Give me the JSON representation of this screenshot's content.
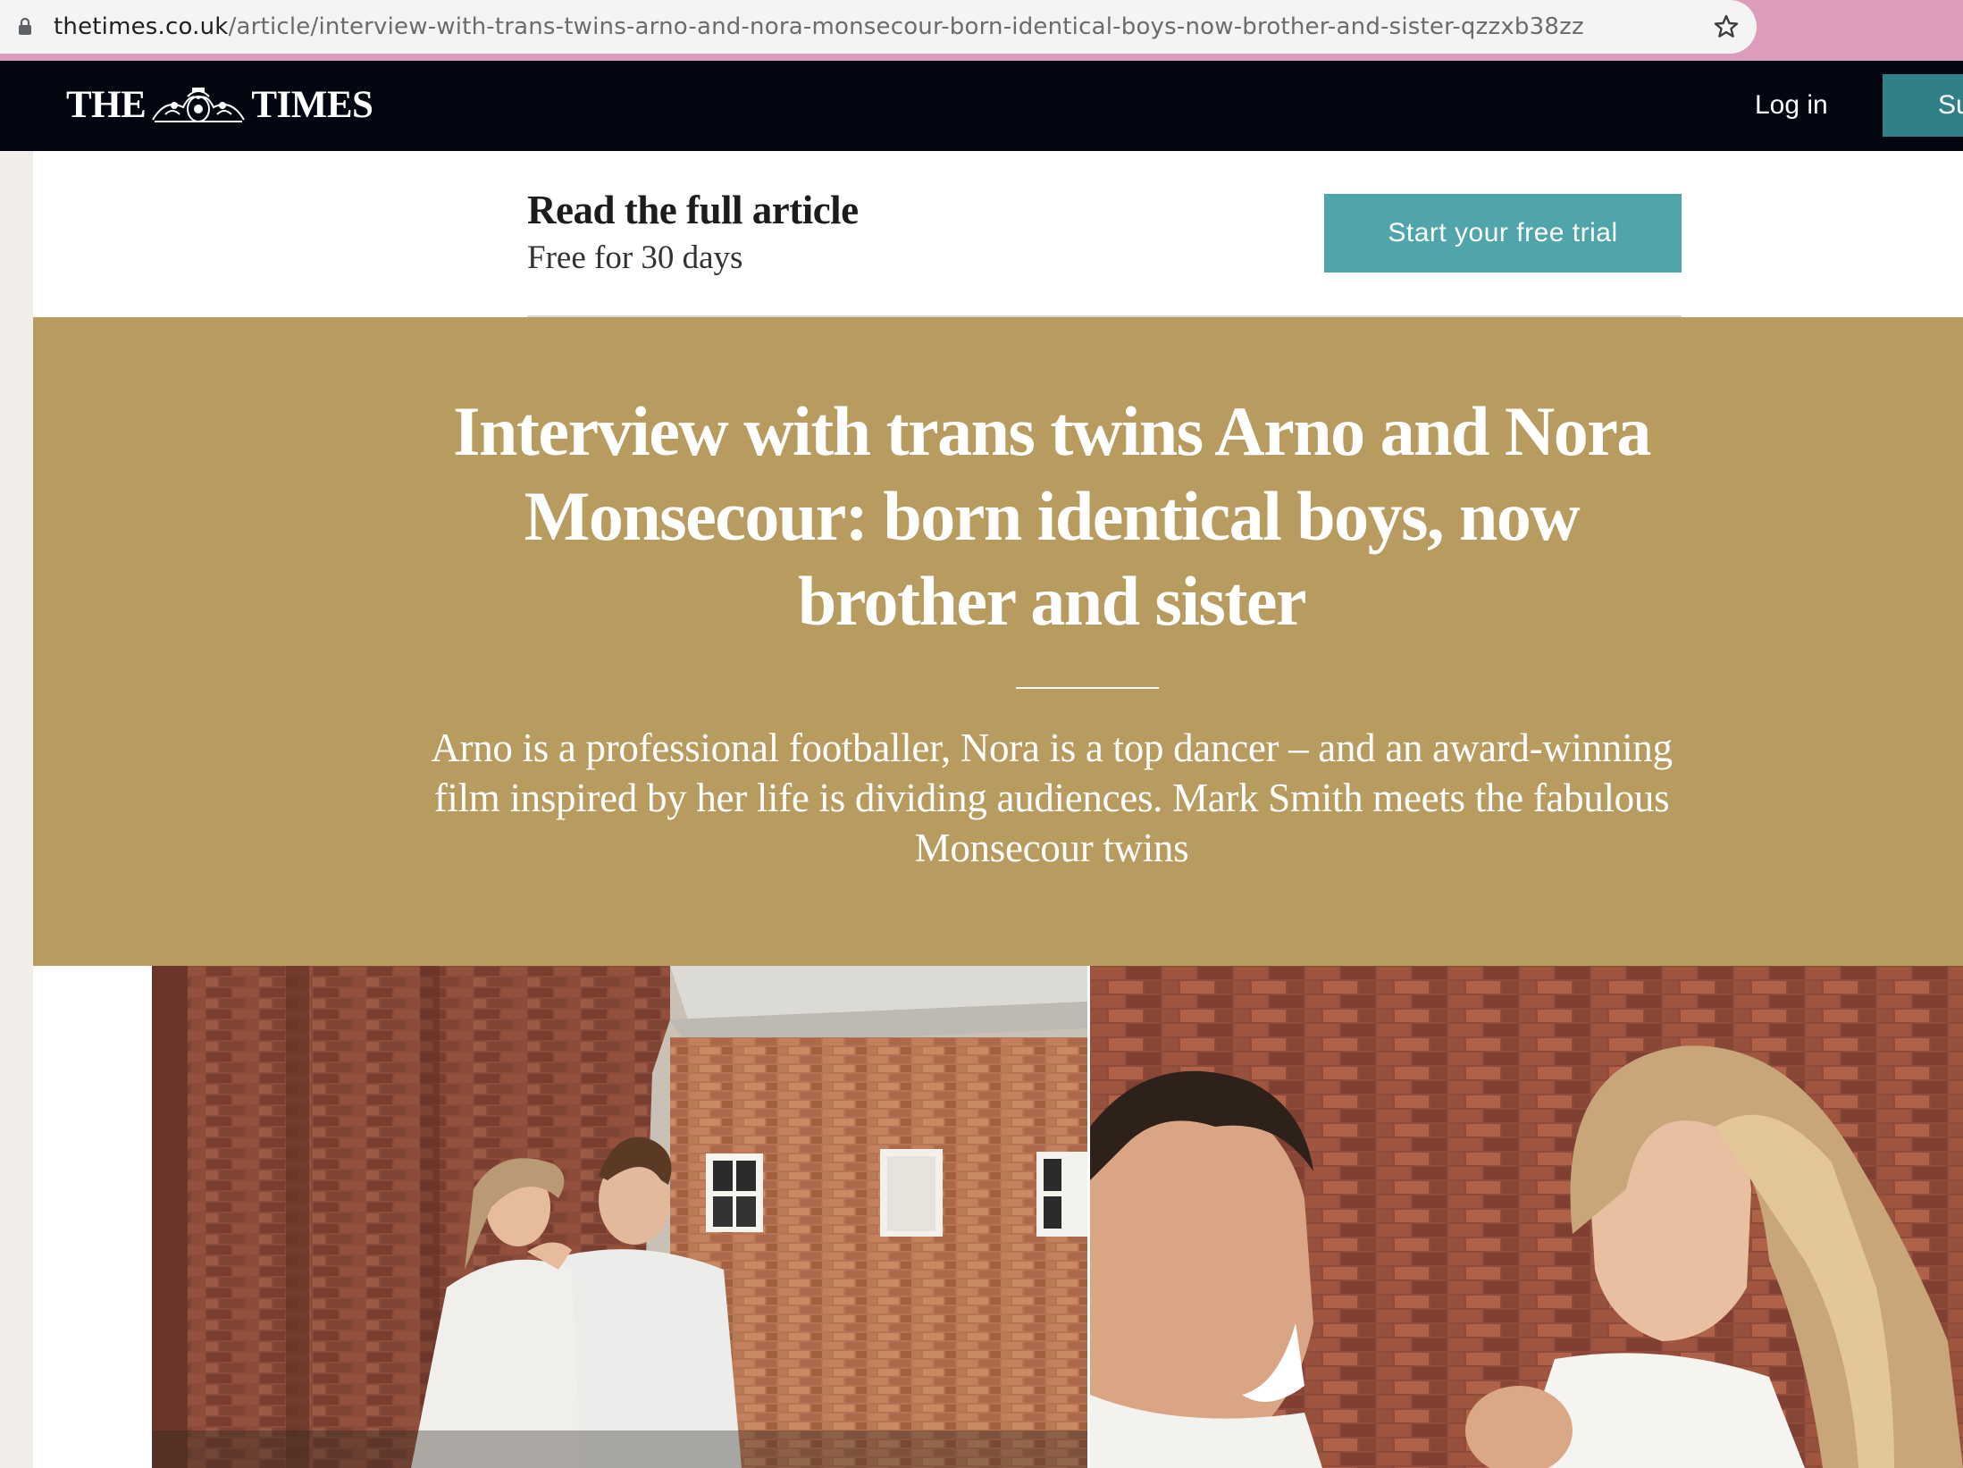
{
  "browser": {
    "url_host": "thetimes.co.uk",
    "url_path": "/article/interview-with-trans-twins-arno-and-nora-monsecour-born-identical-boys-now-brother-and-sister-qzzxb38zz"
  },
  "header": {
    "logo_left": "THE",
    "logo_right": "TIMES",
    "login_label": "Log in",
    "subscribe_label": "Su"
  },
  "paywall": {
    "title": "Read the full article",
    "subtitle": "Free for 30 days",
    "cta_label": "Start your free trial"
  },
  "article": {
    "headline": "Interview with trans twins Arno and Nora Monsecour: born identical boys, now brother and sister",
    "standfirst": "Arno is a professional footballer, Nora is a top dancer – and an award-winning film inspired by her life is dividing audiences. Mark Smith meets the fabulous Monsecour twins"
  },
  "colors": {
    "header_bg": "#030510",
    "hero_bg": "#b89b5e",
    "cta_bg": "#4fa5a9",
    "subscribe_bg": "#2f8187",
    "browser_accent": "#dc9dbd"
  },
  "icons": [
    "lock-icon",
    "star-icon",
    "times-crest-icon"
  ]
}
